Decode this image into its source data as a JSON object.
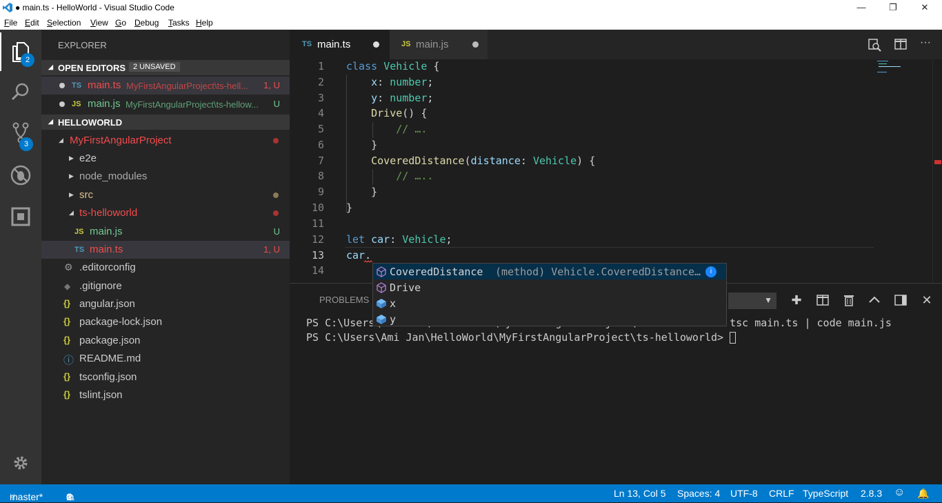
{
  "window": {
    "title": "● main.ts - HelloWorld - Visual Studio Code",
    "minimize": "—",
    "maximize": "❐",
    "close": "✕"
  },
  "menu": [
    "File",
    "Edit",
    "Selection",
    "View",
    "Go",
    "Debug",
    "Tasks",
    "Help"
  ],
  "activity": {
    "explorer_badge": "2",
    "scm_badge": "3"
  },
  "sidebar": {
    "title": "EXPLORER",
    "open_editors": {
      "label": "OPEN EDITORS",
      "badge": "2 UNSAVED",
      "items": [
        {
          "type": "TS",
          "name": "main.ts",
          "path": "MyFirstAngularProject\\ts-hell...",
          "status": "1, U"
        },
        {
          "type": "JS",
          "name": "main.js",
          "path": "MyFirstAngularProject\\ts-hellow...",
          "status": "U"
        }
      ]
    },
    "workspace": {
      "label": "HELLOWORLD",
      "project": "MyFirstAngularProject",
      "folders": [
        "e2e",
        "node_modules",
        "src",
        "ts-helloworld"
      ],
      "ts_children": [
        {
          "type": "JS",
          "name": "main.js",
          "status": "U"
        },
        {
          "type": "TS",
          "name": "main.ts",
          "status": "1, U"
        }
      ],
      "files": [
        {
          "icon": "⚙",
          "name": ".editorconfig"
        },
        {
          "icon": "◆",
          "name": ".gitignore"
        },
        {
          "icon": "{}",
          "name": "angular.json"
        },
        {
          "icon": "{}",
          "name": "package-lock.json"
        },
        {
          "icon": "{}",
          "name": "package.json"
        },
        {
          "icon": "ⓘ",
          "name": "README.md"
        },
        {
          "icon": "{}",
          "name": "tsconfig.json"
        },
        {
          "icon": "{}",
          "name": "tslint.json"
        }
      ]
    }
  },
  "tabs": [
    {
      "type": "TS",
      "name": "main.ts"
    },
    {
      "type": "JS",
      "name": "main.js"
    }
  ],
  "editor": {
    "line_numbers": [
      "1",
      "2",
      "3",
      "4",
      "5",
      "6",
      "7",
      "8",
      "9",
      "10",
      "11",
      "12",
      "13",
      "14"
    ]
  },
  "suggest": [
    {
      "label": "CoveredDistance",
      "detail": "(method) Vehicle.CoveredDistance…",
      "kind": "method"
    },
    {
      "label": "Drive",
      "detail": "",
      "kind": "method"
    },
    {
      "label": "x",
      "detail": "",
      "kind": "field"
    },
    {
      "label": "y",
      "detail": "",
      "kind": "field"
    }
  ],
  "panel": {
    "tab": "PROBLEMS",
    "line1": "PS C:\\Users\\Ami Jan\\HelloWorld\\MyFirstAngularProject\\ts-helloworld> ",
    "cmd1": "tsc main.ts | code main.js",
    "line2": "PS C:\\Users\\Ami Jan\\HelloWorld\\MyFirstAngularProject\\ts-helloworld> "
  },
  "status": {
    "branch": "master*",
    "errors": "1",
    "warnings": "0",
    "position": "Ln 13, Col 5",
    "spaces": "Spaces: 4",
    "encoding": "UTF-8",
    "eol": "CRLF",
    "language": "TypeScript",
    "version": "2.8.3"
  },
  "colors": {
    "accent": "#007acc",
    "activity": "#333333",
    "sidebar": "#252526",
    "editor": "#1e1e1e"
  }
}
